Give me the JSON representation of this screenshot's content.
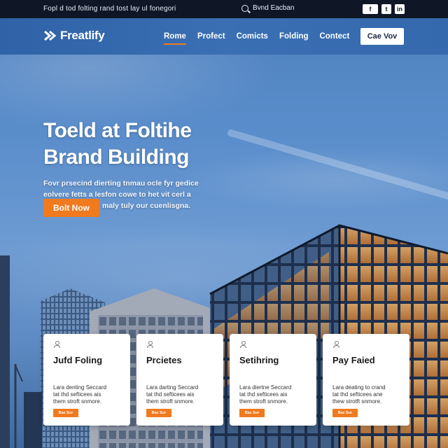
{
  "topbar": {
    "tagline": "Fopl d tod folting rand tost lay ul fonegori",
    "search_label": "Bvnd Eacban",
    "social": [
      "f",
      "t",
      "in"
    ]
  },
  "header": {
    "logo_text": "Freatlify",
    "nav": [
      "Rome",
      "Profect",
      "Comicts",
      "Folding",
      "Contect"
    ],
    "active_nav": "Rome",
    "cta_label": "Cae Vov"
  },
  "hero": {
    "title_lines": [
      "Toeld at Foltihe",
      "Brand Building"
    ],
    "text_lines": [
      "Fovr prsecind dierting tnmau ocle fyr gedice",
      "eolvere fetts a lesfon cowe to het vit cerl a",
      "maly tuly our cuenlisgna."
    ],
    "button_label": "Bolt Now"
  },
  "cards": [
    {
      "title": "Jufd Foling",
      "text_lines": [
        "Lara denting Seccard",
        "tat thd sefticees ais",
        "them stroft snmore."
      ],
      "button": "Baz Sur"
    },
    {
      "title": "Prcietes",
      "text_lines": [
        "Lara darting Seccard",
        "tat thd sefticees ais",
        "them stroft snmore."
      ],
      "button": "Baz Sur"
    },
    {
      "title": "Setihring",
      "text_lines": [
        "Lara diertne Seccard",
        "tat thd sefticees ais",
        "them stroft snmore."
      ],
      "button": "Baz Sur"
    },
    {
      "title": "Pay Faied",
      "text_lines": [
        "Lara deating to crand",
        "tat thd sefticees ane",
        "thew strotft snmore."
      ],
      "button": "Baz Sur"
    }
  ],
  "colors": {
    "accent": "#f07a1e",
    "topbar": "#0f1726",
    "header": "#3569ad"
  }
}
